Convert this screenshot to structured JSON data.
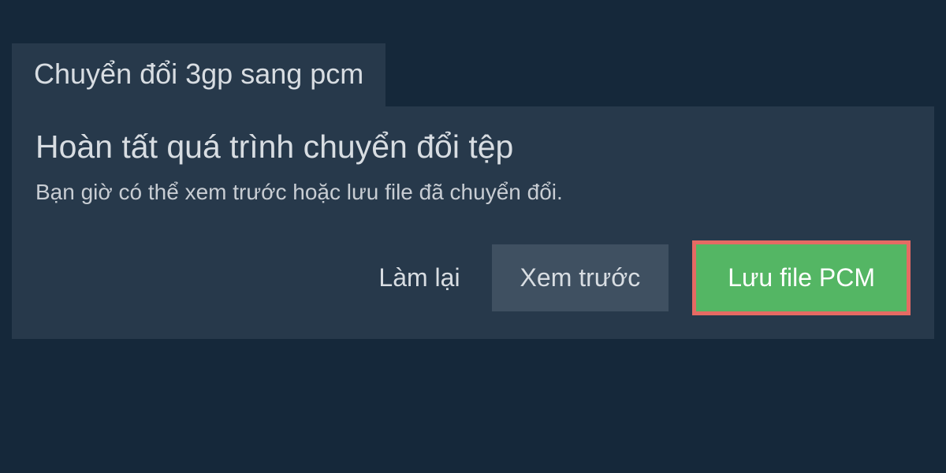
{
  "tab": {
    "label": "Chuyển đổi 3gp sang pcm"
  },
  "panel": {
    "heading": "Hoàn tất quá trình chuyển đổi tệp",
    "description": "Bạn giờ có thể xem trước hoặc lưu file đã chuyển đổi."
  },
  "buttons": {
    "redo": "Làm lại",
    "preview": "Xem trước",
    "save": "Lưu file PCM"
  }
}
